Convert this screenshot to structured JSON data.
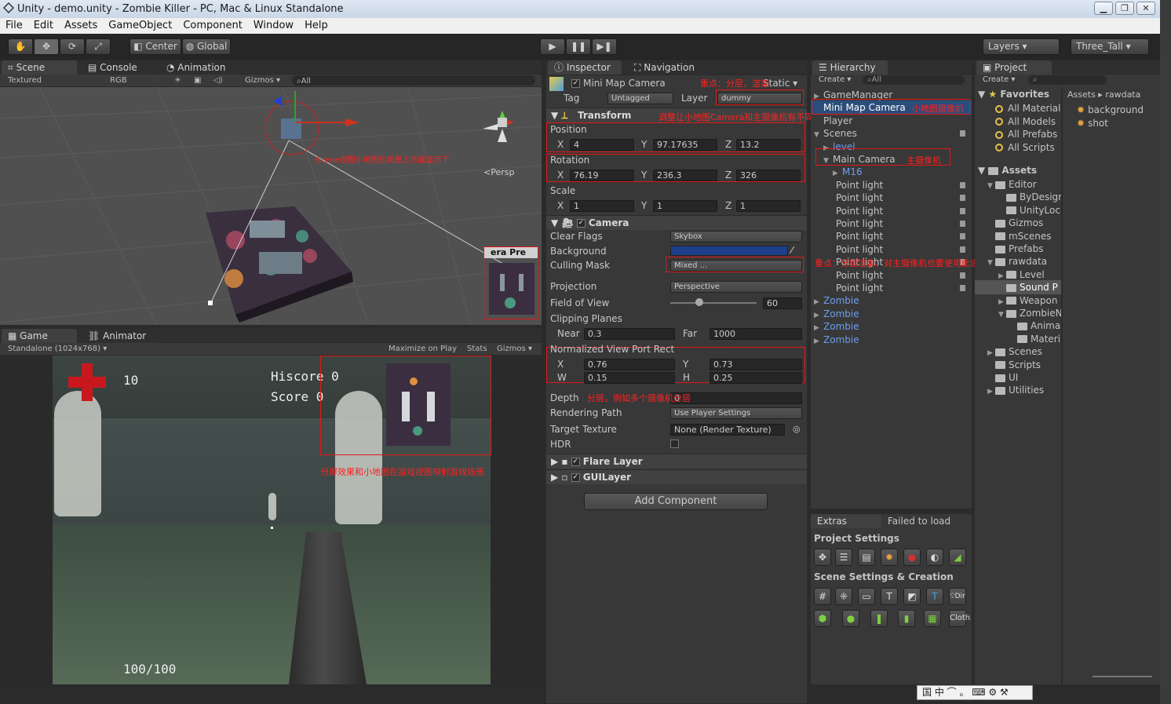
{
  "window": {
    "title": "Unity - demo.unity - Zombie Killer - PC, Mac & Linux Standalone",
    "min": "▁",
    "max": "❐",
    "close": "✕"
  },
  "menu": [
    "File",
    "Edit",
    "Assets",
    "GameObject",
    "Component",
    "Window",
    "Help"
  ],
  "toolbar": {
    "center": "Center",
    "global": "Global",
    "layers": "Layers",
    "layout": "Three_Tall"
  },
  "scene": {
    "tabs": [
      "Scene",
      "Console",
      "Animation"
    ],
    "shading": "Textured",
    "render": "RGB",
    "gizmos": "Gizmos",
    "search": "All",
    "persp": "Persp",
    "preview_title": "era Pre",
    "annotation": "Scene视图小地图在场景上与面显示下"
  },
  "game": {
    "tabs": [
      "Game",
      "Animator"
    ],
    "resolution": "Standalone (1024x768)",
    "maximize": "Maximize on Play",
    "stats": "Stats",
    "gizmos": "Gizmos",
    "health": "10",
    "hiscore": "Hiscore 0",
    "score": "Score 0",
    "ammo": "100/100",
    "annotation": "分屏效果和小地图在游戏视图映射游戏场景"
  },
  "inspector": {
    "tabs": [
      "Inspector",
      "Navigation"
    ],
    "name": "Mini Map Camera",
    "static": "Static",
    "tag_label": "Tag",
    "tag": "Untagged",
    "layer_label": "Layer",
    "layer": "dummy",
    "transform": "Transform",
    "position": "Position",
    "rotation": "Rotation",
    "scale": "Scale",
    "pos": {
      "x": "4",
      "y": "97.17635",
      "z": "13.2"
    },
    "rot": {
      "x": "76.19",
      "y": "236.3",
      "z": "326"
    },
    "scl": {
      "x": "1",
      "y": "1",
      "z": "1"
    },
    "camera": "Camera",
    "clear_flags": "Clear Flags",
    "clear_flags_v": "Skybox",
    "background": "Background",
    "culling": "Culling Mask",
    "culling_v": "Mixed ...",
    "projection": "Projection",
    "projection_v": "Perspective",
    "fov": "Field of View",
    "fov_v": "60",
    "clipping": "Clipping Planes",
    "near": "Near",
    "near_v": "0.3",
    "far": "Far",
    "far_v": "1000",
    "viewport": "Normalized View Port Rect",
    "vx": "0.76",
    "vy": "0.73",
    "vw": "0.15",
    "vh": "0.25",
    "depth": "Depth",
    "depth_v": "0",
    "rendering": "Rendering Path",
    "rendering_v": "Use Player Settings",
    "target": "Target Texture",
    "target_v": "None (Render Texture)",
    "hdr": "HDR",
    "flare": "Flare Layer",
    "guilayer": "GUILayer",
    "add": "Add Component",
    "anno_layer": "重点：分层，渲染",
    "anno_transform": "调整让小地图Camera和主摄像机有不同大小比例",
    "anno_depth": "分层，例如多个摄像机分层"
  },
  "hierarchy": {
    "title": "Hierarchy",
    "create": "Create",
    "search": "All",
    "items": [
      "GameManager",
      "Mini Map Camera",
      "Player",
      "Scenes",
      "level",
      "Main Camera",
      "M16",
      "Point light",
      "Point light",
      "Point light",
      "Point light",
      "Point light",
      "Point light",
      "Point light",
      "Point light",
      "Point light",
      "Zombie",
      "Zombie",
      "Zombie",
      "Zombie"
    ],
    "anno_mini": "小地图摄像机",
    "anno_main": "主摄像机",
    "anno_culling": "重点：分层渲染，对主摄像机也要使用此设置"
  },
  "extras": {
    "tab": "Extras",
    "failed": "Failed to load",
    "project_settings": "Project Settings",
    "scene_settings": "Scene Settings & Creation",
    "dir": "Dir",
    "cloth": "Cloth"
  },
  "project": {
    "title": "Project",
    "create": "Create",
    "breadcrumb": [
      "Assets",
      "rawdata"
    ],
    "favorites": "Favorites",
    "fav_items": [
      "All Material",
      "All Models",
      "All Prefabs",
      "All Scripts"
    ],
    "assets": "Assets",
    "tree": [
      "Editor",
      "ByDesign",
      "UnityLoc",
      "Gizmos",
      "mScenes",
      "Prefabs",
      "rawdata",
      "Level",
      "Sound P",
      "Weapon",
      "ZombieN",
      "Anima",
      "Materi",
      "Scenes",
      "Scripts",
      "UI",
      "Utilities"
    ],
    "files": [
      "background",
      "shot"
    ]
  },
  "ime": "中 ⌒ 。 ⌨ ⚙ ⚒"
}
